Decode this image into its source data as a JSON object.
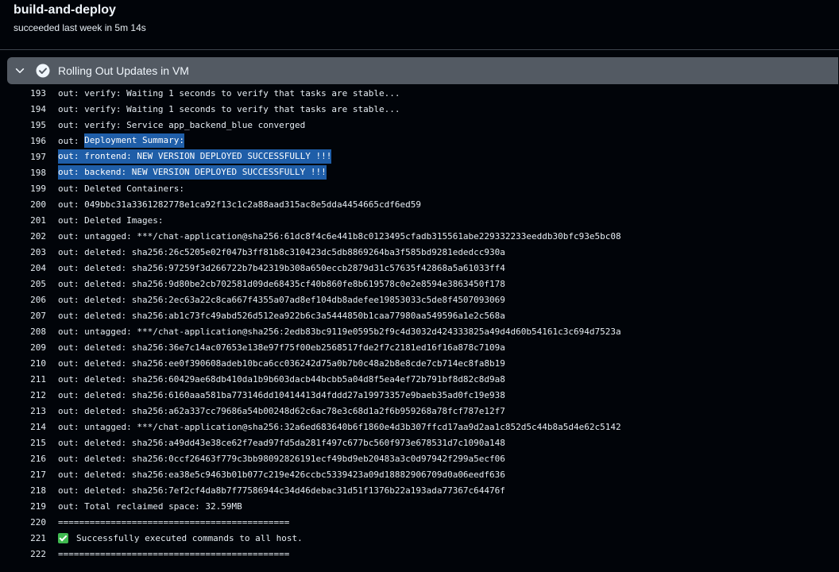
{
  "header": {
    "title": "build-and-deploy",
    "status": "succeeded last week in 5m 14s"
  },
  "step": {
    "title": "Rolling Out Updates in VM",
    "state": "success",
    "expanded": true,
    "icons": [
      "chevron-down-icon",
      "check-circle-icon"
    ]
  },
  "colors": {
    "background": "#010409",
    "step_bar": "#535a63",
    "selection": "#1f5ea8",
    "success": "#3fb950"
  },
  "log": [
    {
      "num": "193",
      "pre": "out: verify: Waiting 1 seconds to verify that tasks are stable...",
      "sel": ""
    },
    {
      "num": "194",
      "pre": "out: verify: Waiting 1 seconds to verify that tasks are stable...",
      "sel": ""
    },
    {
      "num": "195",
      "pre": "out: verify: Service app_backend_blue converged",
      "sel": ""
    },
    {
      "num": "196",
      "pre": "out: ",
      "sel": "Deployment Summary:"
    },
    {
      "num": "197",
      "pre": "",
      "sel": "out: frontend: NEW VERSION DEPLOYED SUCCESSFULLY !!!"
    },
    {
      "num": "198",
      "pre": "",
      "sel": "out: backend: NEW VERSION DEPLOYED SUCCESSFULLY !!!"
    },
    {
      "num": "199",
      "pre": "out: Deleted Containers:",
      "sel": ""
    },
    {
      "num": "200",
      "pre": "out: 049bbc31a3361282778e1ca92f13c1c2a88aad315ac8e5dda4454665cdf6ed59",
      "sel": ""
    },
    {
      "num": "201",
      "pre": "out: Deleted Images:",
      "sel": ""
    },
    {
      "num": "202",
      "pre": "out: untagged: ***/chat-application@sha256:61dc8f4c6e441b8c0123495cfadb315561abe229332233eeddb30bfc93e5bc08",
      "sel": ""
    },
    {
      "num": "203",
      "pre": "out: deleted: sha256:26c5205e02f047b3ff81b8c310423dc5db8869264ba3f585bd9281ededcc930a",
      "sel": ""
    },
    {
      "num": "204",
      "pre": "out: deleted: sha256:97259f3d266722b7b42319b308a650eccb2879d31c57635f42868a5a61033ff4",
      "sel": ""
    },
    {
      "num": "205",
      "pre": "out: deleted: sha256:9d80be2cb702581d09de68435cf40b860fe8b619578c0e2e8594e3863450f178",
      "sel": ""
    },
    {
      "num": "206",
      "pre": "out: deleted: sha256:2ec63a22c8ca667f4355a07ad8ef104db8adefee19853033c5de8f4507093069",
      "sel": ""
    },
    {
      "num": "207",
      "pre": "out: deleted: sha256:ab1c73fc49abd526d512ea922b6c3a5444850b1caa77980aa549596a1e2c568a",
      "sel": ""
    },
    {
      "num": "208",
      "pre": "out: untagged: ***/chat-application@sha256:2edb83bc9119e0595b2f9c4d3032d424333825a49d4d60b54161c3c694d7523a",
      "sel": ""
    },
    {
      "num": "209",
      "pre": "out: deleted: sha256:36e7c14ac07653e138e97f75f00eb2568517fde2f7c2181ed16f16a878c7109a",
      "sel": ""
    },
    {
      "num": "210",
      "pre": "out: deleted: sha256:ee0f390608adeb10bca6cc036242d75a0b7b0c48a2b8e8cde7cb714ec8fa8b19",
      "sel": ""
    },
    {
      "num": "211",
      "pre": "out: deleted: sha256:60429ae68db410da1b9b603dacb44bcbb5a04d8f5ea4ef72b791bf8d82c8d9a8",
      "sel": ""
    },
    {
      "num": "212",
      "pre": "out: deleted: sha256:6160aaa581ba773146dd10414413d4fddd27a19973357e9baeb35ad0fc19e938",
      "sel": ""
    },
    {
      "num": "213",
      "pre": "out: deleted: sha256:a62a337cc79686a54b00248d62c6ac78e3c68d1a2f6b959268a78fcf787e12f7",
      "sel": ""
    },
    {
      "num": "214",
      "pre": "out: untagged: ***/chat-application@sha256:32a6ed683640b6f1860e4d3b307ffcd17aa9d2aa1c852d5c44b8a5d4e62c5142",
      "sel": ""
    },
    {
      "num": "215",
      "pre": "out: deleted: sha256:a49dd43e38ce62f7ead97fd5da281f497c677bc560f973e678531d7c1090a148",
      "sel": ""
    },
    {
      "num": "216",
      "pre": "out: deleted: sha256:0ccf26463f779c3bb98092826191ecf49bd9eb20483a3c0d97942f299a5ecf06",
      "sel": ""
    },
    {
      "num": "217",
      "pre": "out: deleted: sha256:ea38e5c9463b01b077c219e426ccbc5339423a09d18882906709d0a06eedf636",
      "sel": ""
    },
    {
      "num": "218",
      "pre": "out: deleted: sha256:7ef2cf4da8b7f77586944c34d46debac31d51f1376b22a193ada77367c64476f",
      "sel": ""
    },
    {
      "num": "219",
      "pre": "out: Total reclaimed space: 32.59MB",
      "sel": ""
    },
    {
      "num": "220",
      "pre": "============================================",
      "sel": ""
    },
    {
      "num": "221",
      "pre": "Successfully executed commands to all host.",
      "sel": "",
      "emoji": "check-mark-icon"
    },
    {
      "num": "222",
      "pre": "============================================",
      "sel": ""
    }
  ]
}
